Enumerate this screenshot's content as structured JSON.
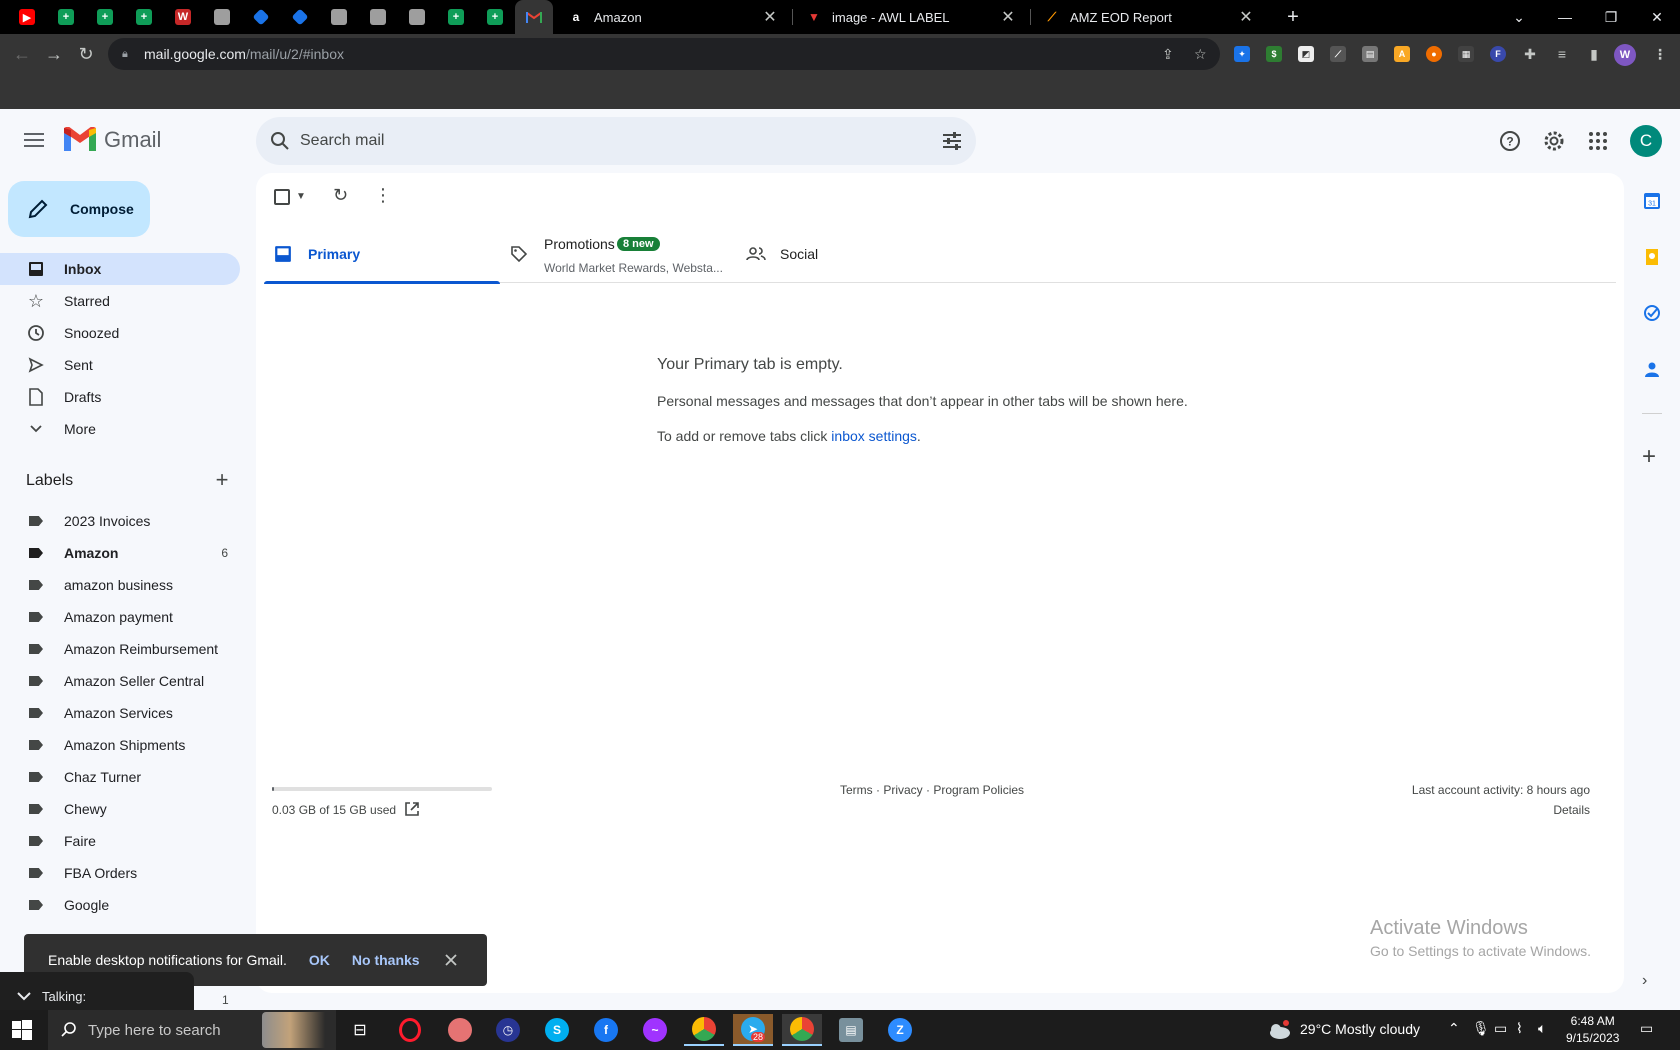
{
  "browser": {
    "tabs": [
      {
        "title": "Amazon",
        "favicon": "amazon-icon"
      },
      {
        "title": "image - AWL LABEL",
        "favicon": "label-icon"
      },
      {
        "title": "AMZ EOD Report",
        "favicon": "report-icon"
      }
    ],
    "url_host": "mail.google.com",
    "url_path": "/mail/u/2/#inbox",
    "profile_initial": "W"
  },
  "gmail": {
    "app_name": "Gmail",
    "search_placeholder": "Search mail",
    "avatar_initial": "C",
    "compose_label": "Compose",
    "nav": [
      {
        "label": "Inbox",
        "icon": "inbox-icon"
      },
      {
        "label": "Starred",
        "icon": "star-icon"
      },
      {
        "label": "Snoozed",
        "icon": "clock-icon"
      },
      {
        "label": "Sent",
        "icon": "send-icon"
      },
      {
        "label": "Drafts",
        "icon": "draft-icon"
      },
      {
        "label": "More",
        "icon": "chevron-down-icon"
      }
    ],
    "labels_title": "Labels",
    "labels": [
      {
        "name": "2023 Invoices",
        "count": ""
      },
      {
        "name": "Amazon",
        "count": "6"
      },
      {
        "name": "amazon business",
        "count": ""
      },
      {
        "name": "Amazon payment",
        "count": ""
      },
      {
        "name": "Amazon Reimbursement",
        "count": ""
      },
      {
        "name": "Amazon Seller Central",
        "count": ""
      },
      {
        "name": "Amazon Services",
        "count": ""
      },
      {
        "name": "Amazon Shipments",
        "count": ""
      },
      {
        "name": "Chaz Turner",
        "count": ""
      },
      {
        "name": "Chewy",
        "count": ""
      },
      {
        "name": "Faire",
        "count": ""
      },
      {
        "name": "FBA Orders",
        "count": ""
      },
      {
        "name": "Google",
        "count": ""
      }
    ],
    "category_tabs": {
      "primary": "Primary",
      "promotions": "Promotions",
      "promotions_badge": "8 new",
      "promotions_sub": "World Market Rewards, Websta...",
      "social": "Social"
    },
    "empty": {
      "title": "Your Primary tab is empty.",
      "line1": "Personal messages and messages that don’t appear in other tabs will be shown here.",
      "line2_prefix": "To add or remove tabs click ",
      "line2_link": "inbox settings",
      "line2_suffix": "."
    },
    "footer": {
      "storage_text": "0.03 GB of 15 GB used",
      "storage_fraction": 0.002,
      "links": "Terms · Privacy · Program Policies",
      "last_activity": "Last account activity: 8 hours ago",
      "details": "Details"
    },
    "toast": {
      "message": "Enable desktop notifications for Gmail.",
      "ok": "OK",
      "no_thanks": "No thanks"
    },
    "talking": "Talking:",
    "stray_count": "1"
  },
  "watermark": {
    "line1": "Activate Windows",
    "line2": "Go to Settings to activate Windows."
  },
  "taskbar": {
    "search_placeholder": "Type here to search",
    "weather": "29°C  Mostly cloudy",
    "time": "6:48 AM",
    "date": "9/15/2023",
    "telegram_badge": "28"
  }
}
